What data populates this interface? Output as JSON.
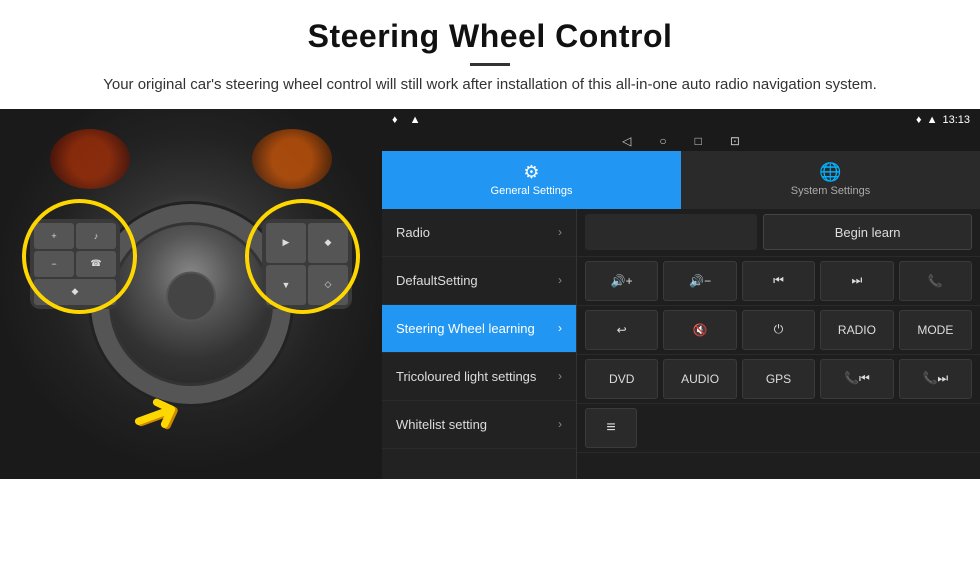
{
  "header": {
    "title": "Steering Wheel Control",
    "divider": true,
    "description": "Your original car's steering wheel control will still work after installation of this all-in-one auto radio navigation system."
  },
  "statusBar": {
    "time": "13:13",
    "navIcons": [
      "◁",
      "○",
      "□",
      "⊡"
    ]
  },
  "tabs": [
    {
      "id": "general",
      "label": "General Settings",
      "icon": "⚙",
      "active": true
    },
    {
      "id": "system",
      "label": "System Settings",
      "icon": "🌐",
      "active": false
    }
  ],
  "menuItems": [
    {
      "id": "radio",
      "label": "Radio",
      "active": false
    },
    {
      "id": "default",
      "label": "DefaultSetting",
      "active": false
    },
    {
      "id": "steering",
      "label": "Steering Wheel learning",
      "active": true
    },
    {
      "id": "tricoloured",
      "label": "Tricoloured light settings",
      "active": false
    },
    {
      "id": "whitelist",
      "label": "Whitelist setting",
      "active": false
    }
  ],
  "controls": {
    "beginLearn": "Begin learn",
    "row1": [
      "🔊+",
      "🔊−",
      "⏮",
      "⏭",
      "📞"
    ],
    "row2": [
      "↩",
      "🔇",
      "⏻",
      "RADIO",
      "MODE"
    ],
    "row3": [
      "DVD",
      "AUDIO",
      "GPS",
      "📞⏮",
      "📞⏭"
    ],
    "row4_icon": "≡"
  }
}
